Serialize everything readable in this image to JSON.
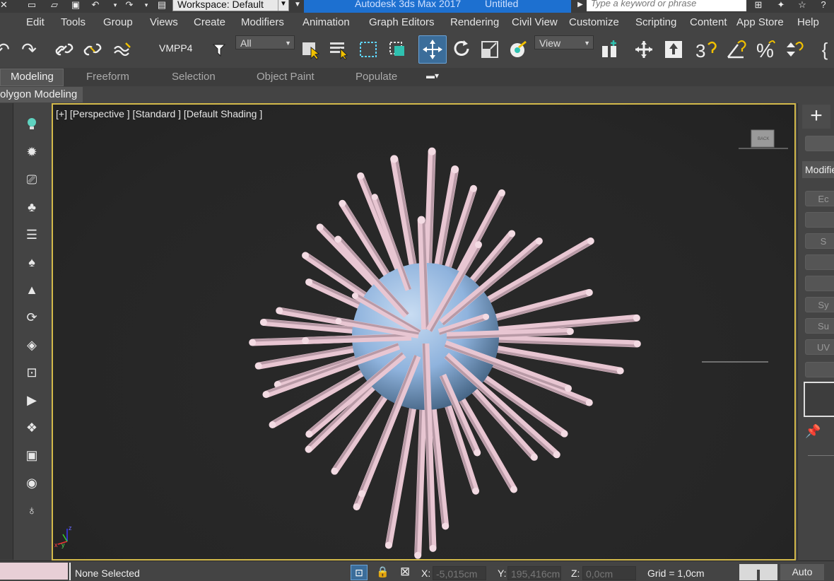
{
  "titlebar": {
    "workspace_label": "Workspace: Default",
    "app_title": "Autodesk 3ds Max 2017",
    "file_title": "Untitled",
    "search_placeholder": "Type a keyword or phrase"
  },
  "menu": [
    "Edit",
    "Tools",
    "Group",
    "Views",
    "Create",
    "Modifiers",
    "Animation",
    "Graph Editors",
    "Rendering",
    "Civil View",
    "Customize",
    "Scripting",
    "Content",
    "App Store",
    "Help"
  ],
  "toolbar": {
    "selection_set": "VMPP4",
    "filter_dropdown": "All",
    "reference_coord_dropdown": "View"
  },
  "ribbon": {
    "tabs": [
      "Modeling",
      "Freeform",
      "Selection",
      "Object Paint",
      "Populate"
    ],
    "active_tab": "Modeling",
    "panel_label": "olygon Modeling"
  },
  "viewport": {
    "label": "[+] [Perspective ] [Standard ] [Default Shading ]",
    "viewcube_face": "BACK",
    "sphere_color": "#8fb3dd",
    "spike_color": "#e8c6d2",
    "axis_labels": {
      "x": "x",
      "y": "y",
      "z": "z"
    }
  },
  "command_panel": {
    "tab_label": "Modifie",
    "buttons": [
      "Ec",
      "",
      "S",
      "",
      "",
      "Sy",
      "Su",
      "UV",
      ""
    ]
  },
  "statusbar": {
    "selection_status": "None Selected",
    "x_label": "X:",
    "x_value": "-5,015cm",
    "y_label": "Y:",
    "y_value": "195,416cm",
    "z_label": "Z:",
    "z_value": "0,0cm",
    "grid": "Grid = 1,0cm",
    "auto_key": "Auto"
  },
  "colors": {
    "viewport_border": "#d3b94a",
    "title_highlight": "#1d70d0"
  }
}
